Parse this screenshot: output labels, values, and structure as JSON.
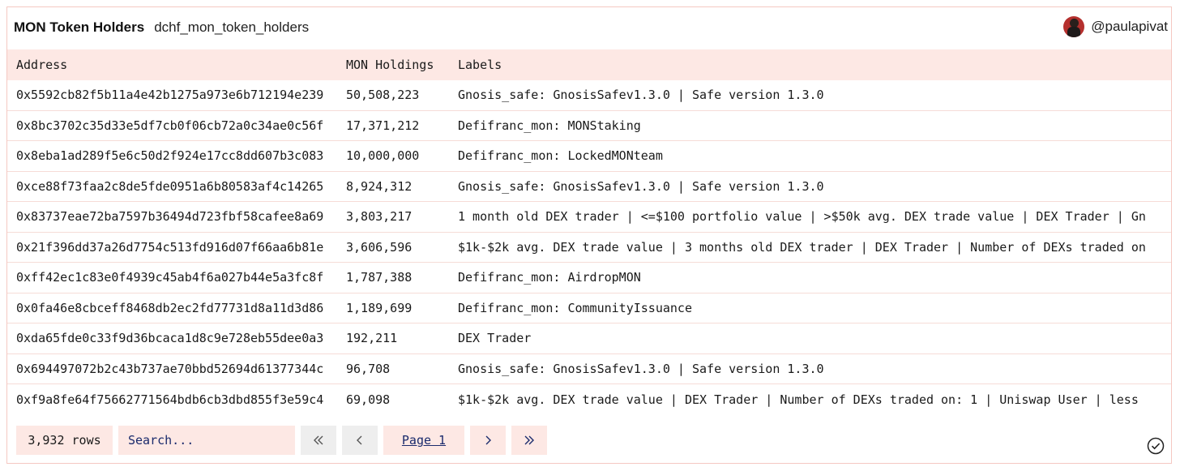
{
  "header": {
    "title": "MON Token Holders",
    "subtitle": "dchf_mon_token_holders",
    "username": "@paulapivat"
  },
  "table": {
    "columns": [
      "Address",
      "MON Holdings",
      "Labels"
    ],
    "rows": [
      [
        "0x5592cb82f5b11a4e42b1275a973e6b712194e239",
        "50,508,223",
        "Gnosis_safe: GnosisSafev1.3.0 | Safe version 1.3.0"
      ],
      [
        "0x8bc3702c35d33e5df7cb0f06cb72a0c34ae0c56f",
        "17,371,212",
        "Defifranc_mon: MONStaking"
      ],
      [
        "0x8eba1ad289f5e6c50d2f924e17cc8dd607b3c083",
        "10,000,000",
        "Defifranc_mon: LockedMONteam"
      ],
      [
        "0xce88f73faa2c8de5fde0951a6b80583af4c14265",
        "8,924,312",
        "Gnosis_safe: GnosisSafev1.3.0 | Safe version 1.3.0"
      ],
      [
        "0x83737eae72ba7597b36494d723fbf58cafee8a69",
        "3,803,217",
        "1 month old DEX trader | <=$100 portfolio value | >$50k avg. DEX trade value | DEX Trader | Gn"
      ],
      [
        "0x21f396dd37a26d7754c513fd916d07f66aa6b81e",
        "3,606,596",
        "$1k-$2k avg. DEX trade value | 3 months old DEX trader | DEX Trader | Number of DEXs traded on"
      ],
      [
        "0xff42ec1c83e0f4939c45ab4f6a027b44e5a3fc8f",
        "1,787,388",
        "Defifranc_mon: AirdropMON"
      ],
      [
        "0x0fa46e8cbceff8468db2ec2fd77731d8a11d3d86",
        "1,189,699",
        "Defifranc_mon: CommunityIssuance"
      ],
      [
        "0xda65fde0c33f9d36bcaca1d8c9e728eb55dee0a3",
        "192,211",
        "DEX Trader"
      ],
      [
        "0x694497072b2c43b737ae70bbd52694d61377344c",
        "96,708",
        "Gnosis_safe: GnosisSafev1.3.0 | Safe version 1.3.0"
      ],
      [
        "0xf9a8fe64f75662771564bdb6cb3dbd855f3e59c4",
        "69,098",
        "$1k-$2k avg. DEX trade value | DEX Trader | Number of DEXs traded on: 1 | Uniswap User | less"
      ]
    ]
  },
  "footer": {
    "row_count": "3,932 rows",
    "search_placeholder": "Search...",
    "page_label": "Page 1"
  },
  "icons": {
    "first": "double-chevron-left-icon",
    "prev": "chevron-left-icon",
    "next": "chevron-right-icon",
    "last": "double-chevron-right-icon",
    "status": "check-circle-icon"
  },
  "colors": {
    "accent_bg": "#fde8e4",
    "border": "#f5c8c2",
    "link": "#1a2a6c"
  }
}
